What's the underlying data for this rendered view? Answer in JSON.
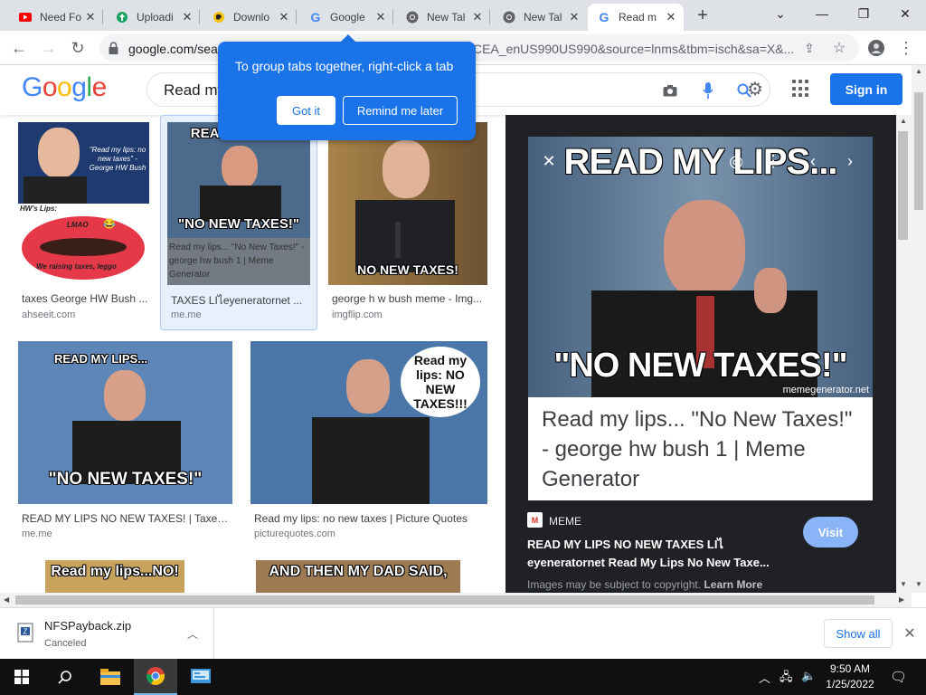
{
  "browser": {
    "tabs": [
      {
        "title": "Need Fo",
        "icon": "youtube-icon",
        "color": "#ff0000"
      },
      {
        "title": "Uploadi",
        "icon": "upload-icon",
        "color": "#1aa260"
      },
      {
        "title": "Downlo",
        "icon": "download-site-icon",
        "color": "#e0a800"
      },
      {
        "title": "Google",
        "icon": "google-icon",
        "color": "#4285f4"
      },
      {
        "title": "New Tal",
        "icon": "chrome-icon",
        "color": "#5f6368"
      },
      {
        "title": "New Tal",
        "icon": "chrome-icon",
        "color": "#5f6368"
      },
      {
        "title": "Read m",
        "icon": "google-icon",
        "color": "#4285f4",
        "active": true
      }
    ],
    "url_visible": "google.com/sea",
    "url_tail": "CEA_enUS990US990&source=lnms&tbm=isch&sa=X&..."
  },
  "tooltip": {
    "text": "To group tabs together, right-click a tab",
    "got_it": "Got it",
    "remind_later": "Remind me later"
  },
  "google": {
    "logo": "Google",
    "query": "Read my",
    "sign_in": "Sign in",
    "brand_blue": "#1a73e8"
  },
  "results": [
    {
      "caption": "taxes George HW Bush ...",
      "source": "ahseeit.com"
    },
    {
      "caption": "TAXES LIไeyeneratornet ...",
      "source": "me.me"
    },
    {
      "caption": "george h w bush meme - Img...",
      "source": "imgflip.com"
    },
    {
      "caption": "READ MY LIPS NO NEW TAXES! | Taxes ...",
      "source": "me.me"
    },
    {
      "caption": "Read my lips: no new taxes | Picture Quotes",
      "source": "picturequotes.com"
    }
  ],
  "thumbs": {
    "t1_quote": "\"Read my lips: no new taxes\" -George HW Bush",
    "t1_lips_label": "HW's Lips:",
    "t1_lmao": "LMAO",
    "t1_raising": "We raising taxes, leggo",
    "t2_top": "READ MY LIPS",
    "t2_bottom": "\"NO NEW TAXES!\"",
    "t2_overlay": "Read my lips... \"No New Taxes!\" - george hw bush 1 | Meme Generator",
    "t3_bottom": "NO NEW TAXES!",
    "t4_top": "READ MY LIPS...",
    "t4_bottom": "\"NO NEW TAXES!\"",
    "t5_bubble": "Read my lips: NO NEW TAXES!!!",
    "t6_top": "Read my lips...NO!",
    "t7_top": "AND THEN MY DAD SAID,"
  },
  "panel": {
    "meme_top": "READ MY LIPS...",
    "meme_bottom": "\"NO NEW TAXES!\"",
    "watermark": "memegenerator.net",
    "text_card": "Read my lips... \"No New Taxes!\" - george hw bush 1 | Meme Generator",
    "site_icon": "M",
    "site_name": "MEME",
    "visit": "Visit",
    "title_line1": "READ MY LIPS NO NEW TAXES LIไ",
    "title_line2": "eyeneratornet Read My Lips No New Taxe...",
    "copyright": "Images may be subject to copyright.",
    "learn_more": "Learn More"
  },
  "download": {
    "filename": "NFSPayback.zip",
    "status": "Canceled",
    "show_all": "Show all"
  },
  "taskbar": {
    "time": "9:50 AM",
    "date": "1/25/2022"
  }
}
